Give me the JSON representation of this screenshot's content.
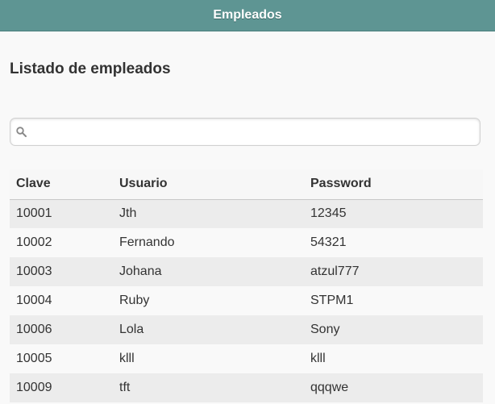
{
  "header": {
    "title": "Empleados"
  },
  "page": {
    "title": "Listado de empleados"
  },
  "search": {
    "placeholder": "",
    "value": ""
  },
  "table": {
    "columns": [
      "Clave",
      "Usuario",
      "Password"
    ],
    "rows": [
      [
        "10001",
        "Jth",
        "12345"
      ],
      [
        "10002",
        "Fernando",
        "54321"
      ],
      [
        "10003",
        "Johana",
        "atzul777"
      ],
      [
        "10004",
        "Ruby",
        "STPM1"
      ],
      [
        "10006",
        "Lola",
        "Sony"
      ],
      [
        "10005",
        "klll",
        "klll"
      ],
      [
        "10009",
        "tft",
        "qqqwe"
      ]
    ]
  },
  "colors": {
    "header_bg": "#5e9593",
    "row_odd": "#ececec",
    "row_even": "#f9f9f9"
  }
}
